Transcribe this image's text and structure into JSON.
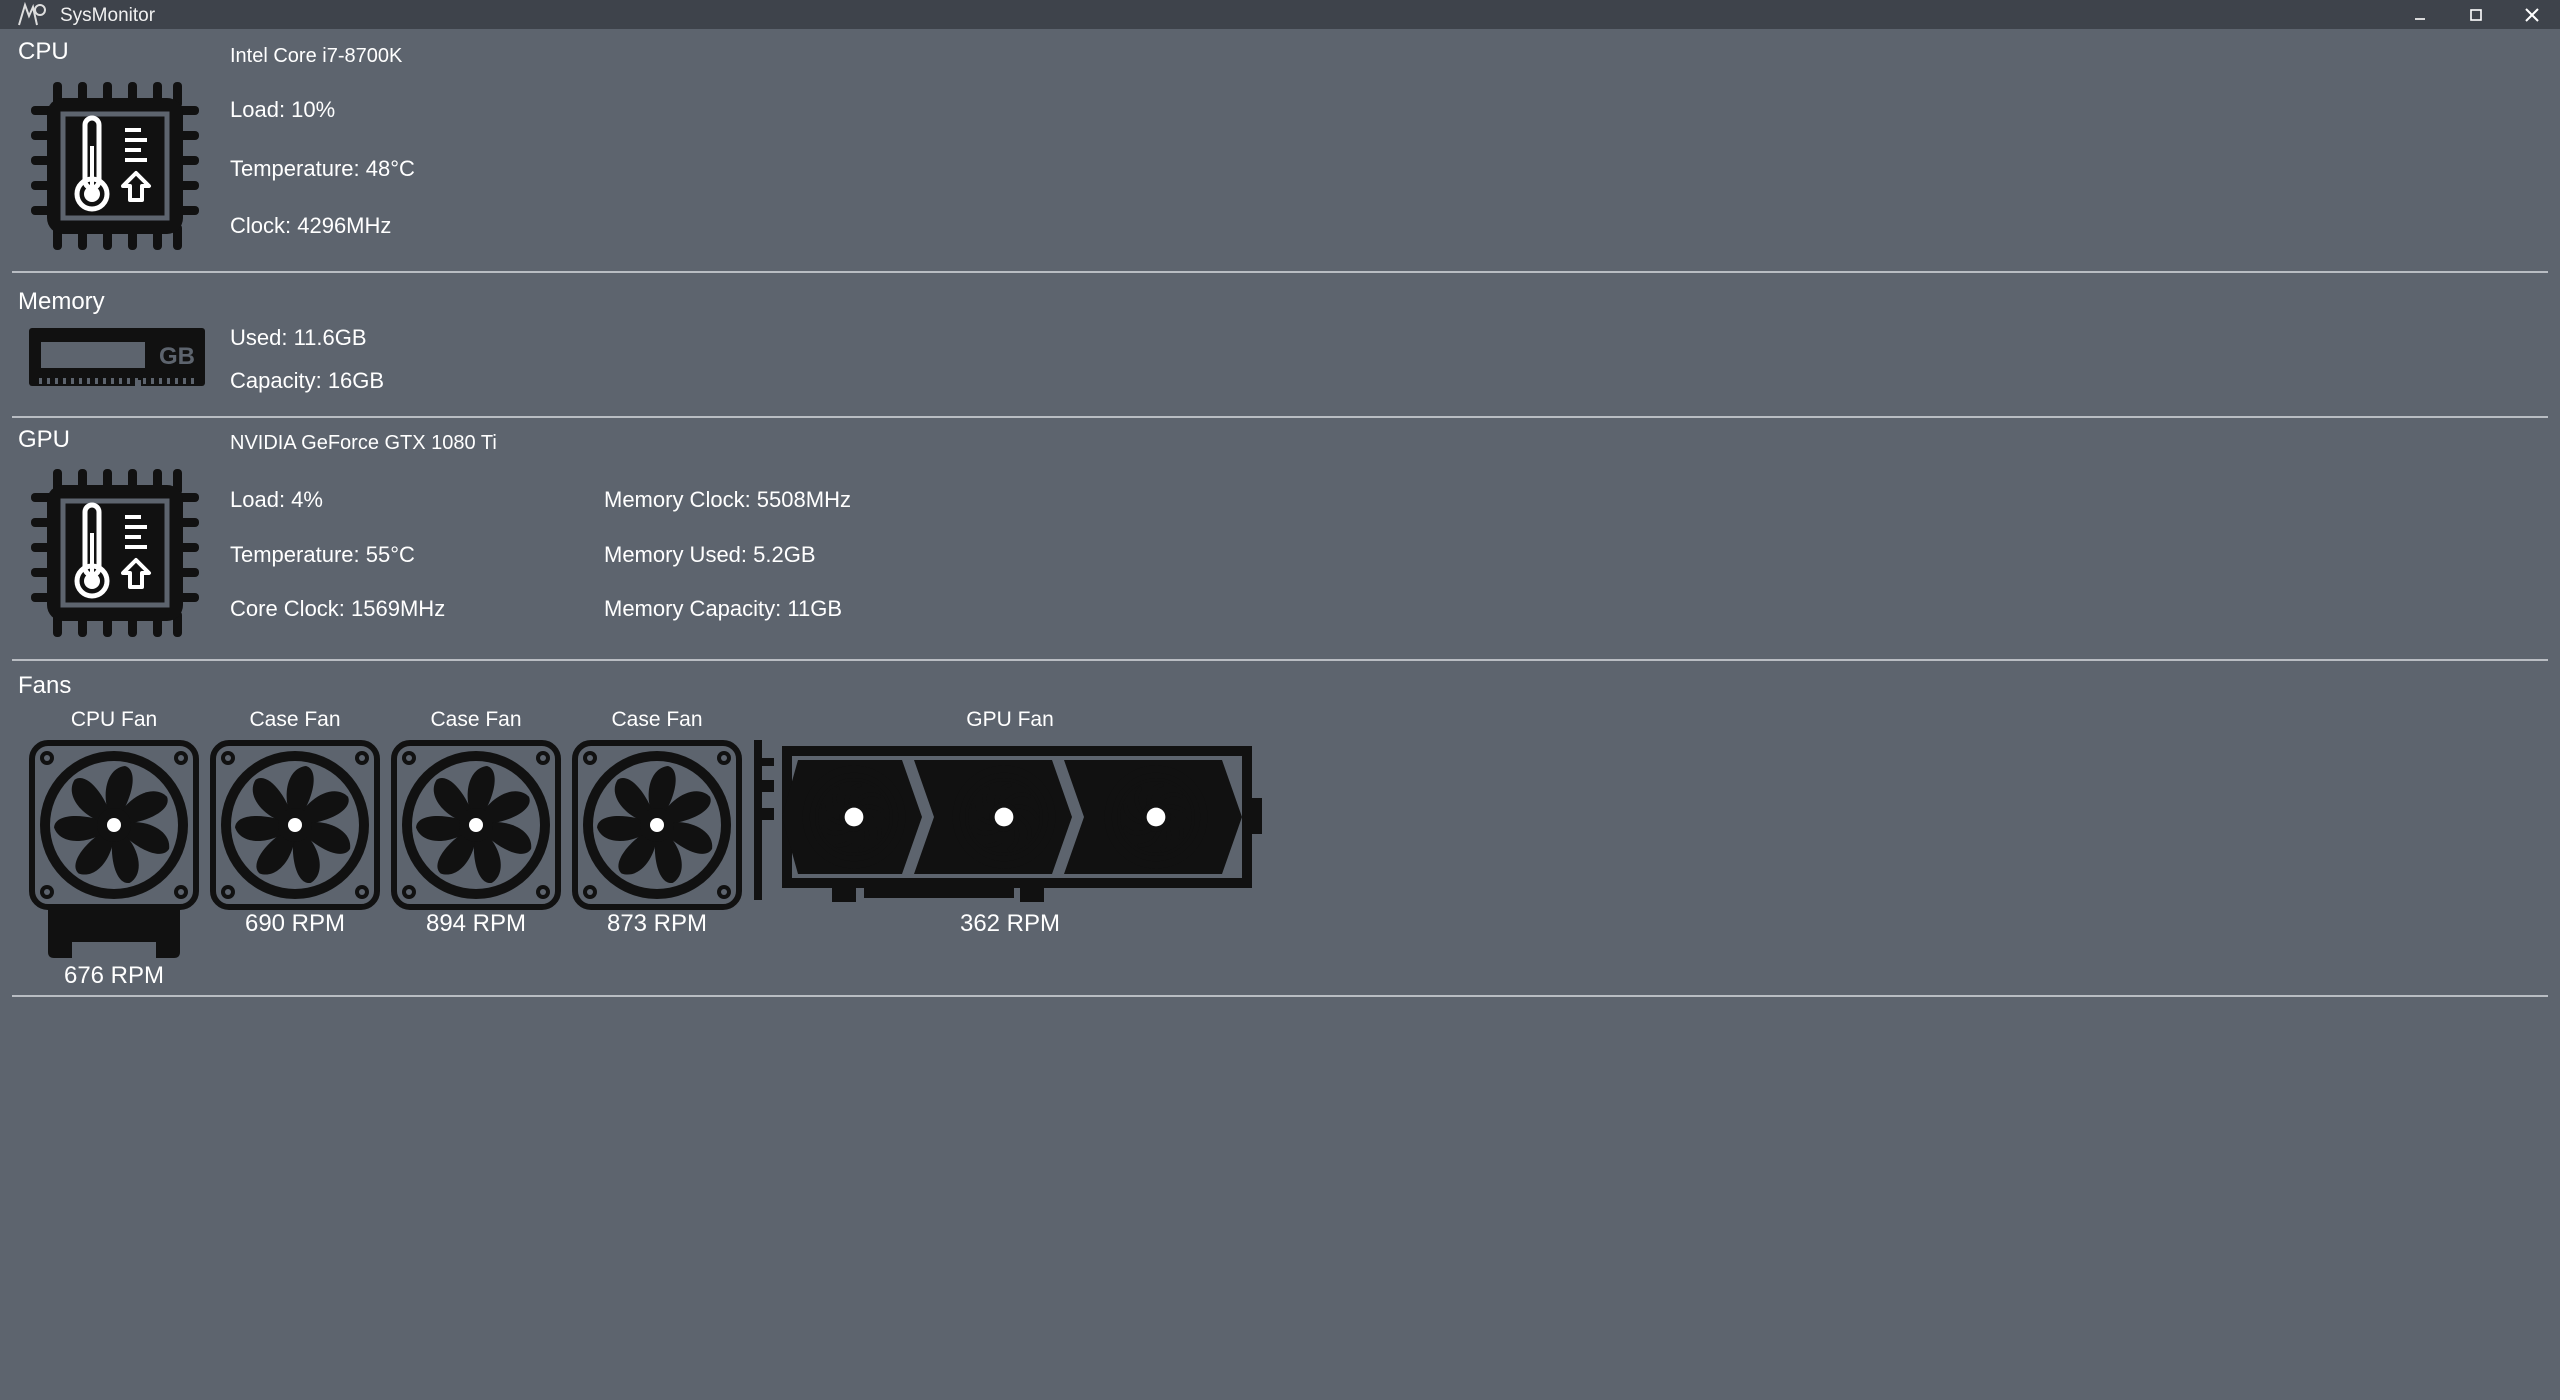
{
  "window": {
    "title": "SysMonitor"
  },
  "cpu": {
    "section_title": "CPU",
    "model": "Intel Core i7-8700K",
    "load": "Load: 10%",
    "temperature": "Temperature: 48°C",
    "clock": "Clock: 4296MHz",
    "icon": "cpu-temperature-icon"
  },
  "memory": {
    "section_title": "Memory",
    "used": "Used: 11.6GB",
    "capacity": "Capacity: 16GB",
    "icon_label": "GB",
    "icon": "ram-stick-icon"
  },
  "gpu": {
    "section_title": "GPU",
    "model": "NVIDIA GeForce GTX 1080 Ti",
    "load": "Load: 4%",
    "temperature": "Temperature: 55°C",
    "core_clock": "Core Clock: 1569MHz",
    "memory_clock": "Memory Clock: 5508MHz",
    "memory_used": "Memory Used: 5.2GB",
    "memory_capacity": "Memory Capacity: 11GB",
    "icon": "gpu-temperature-icon"
  },
  "fans": {
    "section_title": "Fans",
    "items": [
      {
        "label": "CPU Fan",
        "rpm": "676 RPM",
        "icon": "cpu-cooler-icon"
      },
      {
        "label": "Case Fan",
        "rpm": "690 RPM",
        "icon": "case-fan-icon"
      },
      {
        "label": "Case Fan",
        "rpm": "894 RPM",
        "icon": "case-fan-icon"
      },
      {
        "label": "Case Fan",
        "rpm": "873 RPM",
        "icon": "case-fan-icon"
      },
      {
        "label": "GPU Fan",
        "rpm": "362 RPM",
        "icon": "graphics-card-icon"
      }
    ]
  },
  "colors": {
    "background": "#5d646e",
    "titlebar": "#3e434b",
    "icon": "#111111",
    "divider": "#b9bdc3"
  }
}
